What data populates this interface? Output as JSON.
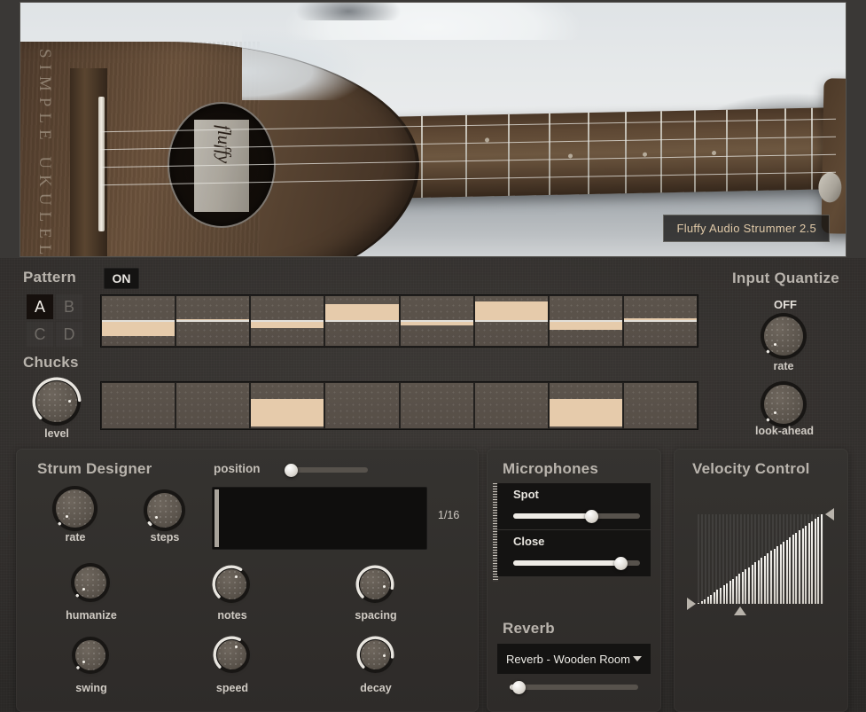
{
  "hero": {
    "instrument_name": "SIMPLE UKULELE",
    "label_text": "fluffy",
    "caption": "Fluffy Audio Strummer 2.5"
  },
  "pattern": {
    "title": "Pattern",
    "on_label": "ON",
    "slots": [
      "A",
      "B",
      "C",
      "D"
    ],
    "selected_slot": "A",
    "steps": 8,
    "step_values": [
      -0.62,
      0.08,
      -0.3,
      0.68,
      -0.18,
      0.8,
      -0.34,
      0.1
    ]
  },
  "chucks": {
    "title": "Chucks",
    "knob_label": "level",
    "knob_value": 0.82,
    "steps": 8,
    "step_active": [
      false,
      false,
      true,
      false,
      false,
      false,
      true,
      false
    ]
  },
  "input_quantize": {
    "title": "Input Quantize",
    "value_label": "OFF",
    "rate_label": "rate",
    "rate_value": 0.0,
    "lookahead_label": "look-ahead",
    "lookahead_value": 0.0
  },
  "strum_designer": {
    "title": "Strum Designer",
    "position_label": "position",
    "position_value": 0.04,
    "division_label": "1/16",
    "knobs": [
      {
        "label": "rate",
        "value": 0.0
      },
      {
        "label": "steps",
        "value": 0.02
      },
      {
        "label": "humanize",
        "value": 0.0
      },
      {
        "label": "notes",
        "value": 0.62
      },
      {
        "label": "spacing",
        "value": 0.88
      },
      {
        "label": "swing",
        "value": 0.0
      },
      {
        "label": "speed",
        "value": 0.6
      },
      {
        "label": "decay",
        "value": 0.86
      }
    ]
  },
  "microphones": {
    "title": "Microphones",
    "channels": [
      {
        "label": "Spot",
        "value": 0.62
      },
      {
        "label": "Close",
        "value": 0.85
      }
    ]
  },
  "reverb": {
    "title": "Reverb",
    "preset": "Reverb - Wooden Room",
    "amount": 0.07
  },
  "velocity_control": {
    "title": "Velocity Control",
    "curve_points": [
      0.0,
      1.0
    ],
    "bar_count": 40,
    "handles": {
      "left": 0.0,
      "right": 1.0,
      "bottom": 0.34
    }
  },
  "colors": {
    "accent": "#e6cbab",
    "panel_bg": "#302d2b",
    "cell_bg": "#5c544c",
    "text": "#cfcac3"
  }
}
